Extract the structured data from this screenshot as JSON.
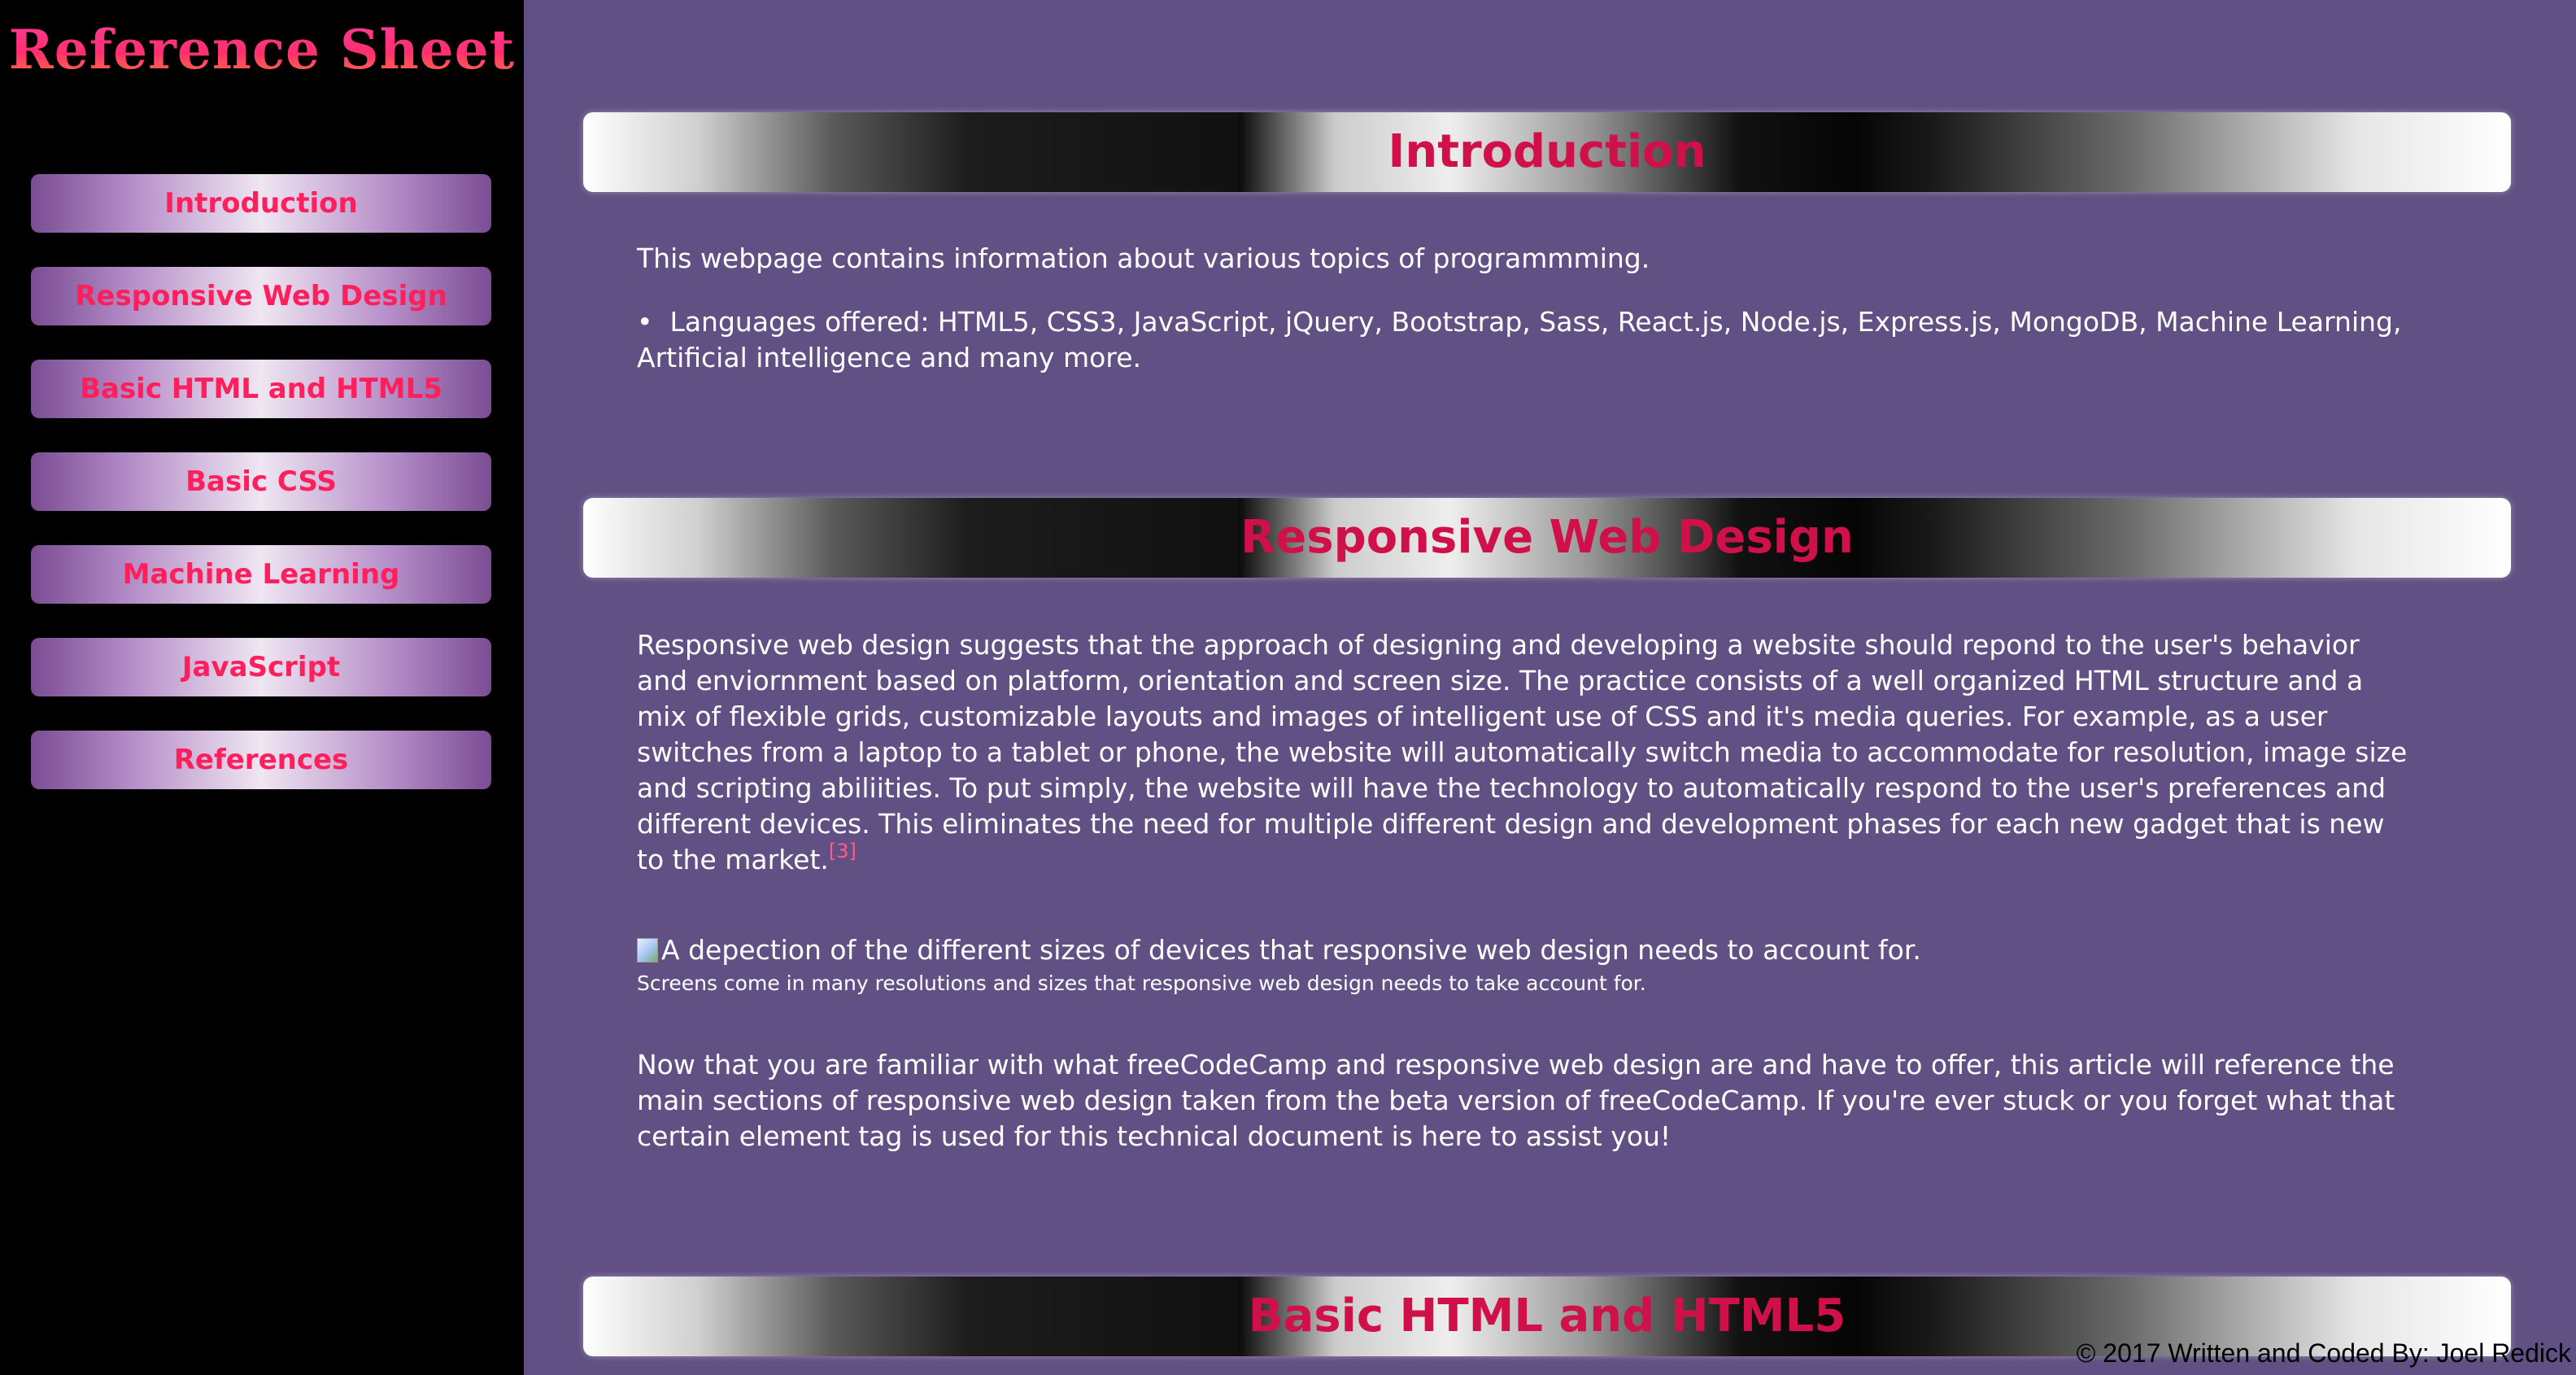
{
  "sidebar": {
    "title": "Reference Sheet",
    "items": [
      {
        "label": "Introduction"
      },
      {
        "label": "Responsive Web Design"
      },
      {
        "label": "Basic HTML and HTML5"
      },
      {
        "label": "Basic CSS"
      },
      {
        "label": "Machine Learning"
      },
      {
        "label": "JavaScript"
      },
      {
        "label": "References"
      }
    ]
  },
  "sections": {
    "introduction": {
      "heading": "Introduction",
      "paragraph": "This webpage contains information about various topics of programmming.",
      "bullet": "Languages offered: HTML5, CSS3, JavaScript, jQuery, Bootstrap, Sass, React.js, Node.js, Express.js, MongoDB, Machine Learning, Artificial intelligence and many more."
    },
    "responsive": {
      "heading": "Responsive Web Design",
      "paragraph1": "Responsive web design suggests that the approach of designing and developing a website should repond to the user's behavior and enviornment based on platform, orientation and screen size. The practice consists of a well organized HTML structure and a mix of flexible grids, customizable layouts and images of intelligent use of CSS and it's media queries. For example, as a user switches from a laptop to a tablet or phone, the website will automatically switch media to accommodate for resolution, image size and scripting abiliities. To put simply, the website will have the technology to automatically respond to the user's preferences and different devices. This eliminates the need for multiple different design and development phases for each new gadget that is new to the market.",
      "citation": "[3]",
      "image_alt": "A depection of the different sizes of devices that responsive web design needs to account for.",
      "caption": "Screens come in many resolutions and sizes that responsive web design needs to take account for.",
      "paragraph2": "Now that you are familiar with what freeCodeCamp and responsive web design are and have to offer, this article will reference the main sections of responsive web design taken from the beta version of freeCodeCamp. If you're ever stuck or you forget what that certain element tag is used for this technical document is here to assist you!"
    },
    "basic_html": {
      "heading": "Basic HTML and HTML5"
    }
  },
  "footer": {
    "text": "© 2017 Written and Coded By: Joel Redick"
  },
  "colors": {
    "sidebar_bg": "#000000",
    "main_bg": "#615083",
    "heading_text": "#d01048",
    "nav_text": "#ff1f5c",
    "title_gradient": [
      "#ff3d9a",
      "#ff7a3d"
    ],
    "citation": "#ff5c8a"
  }
}
